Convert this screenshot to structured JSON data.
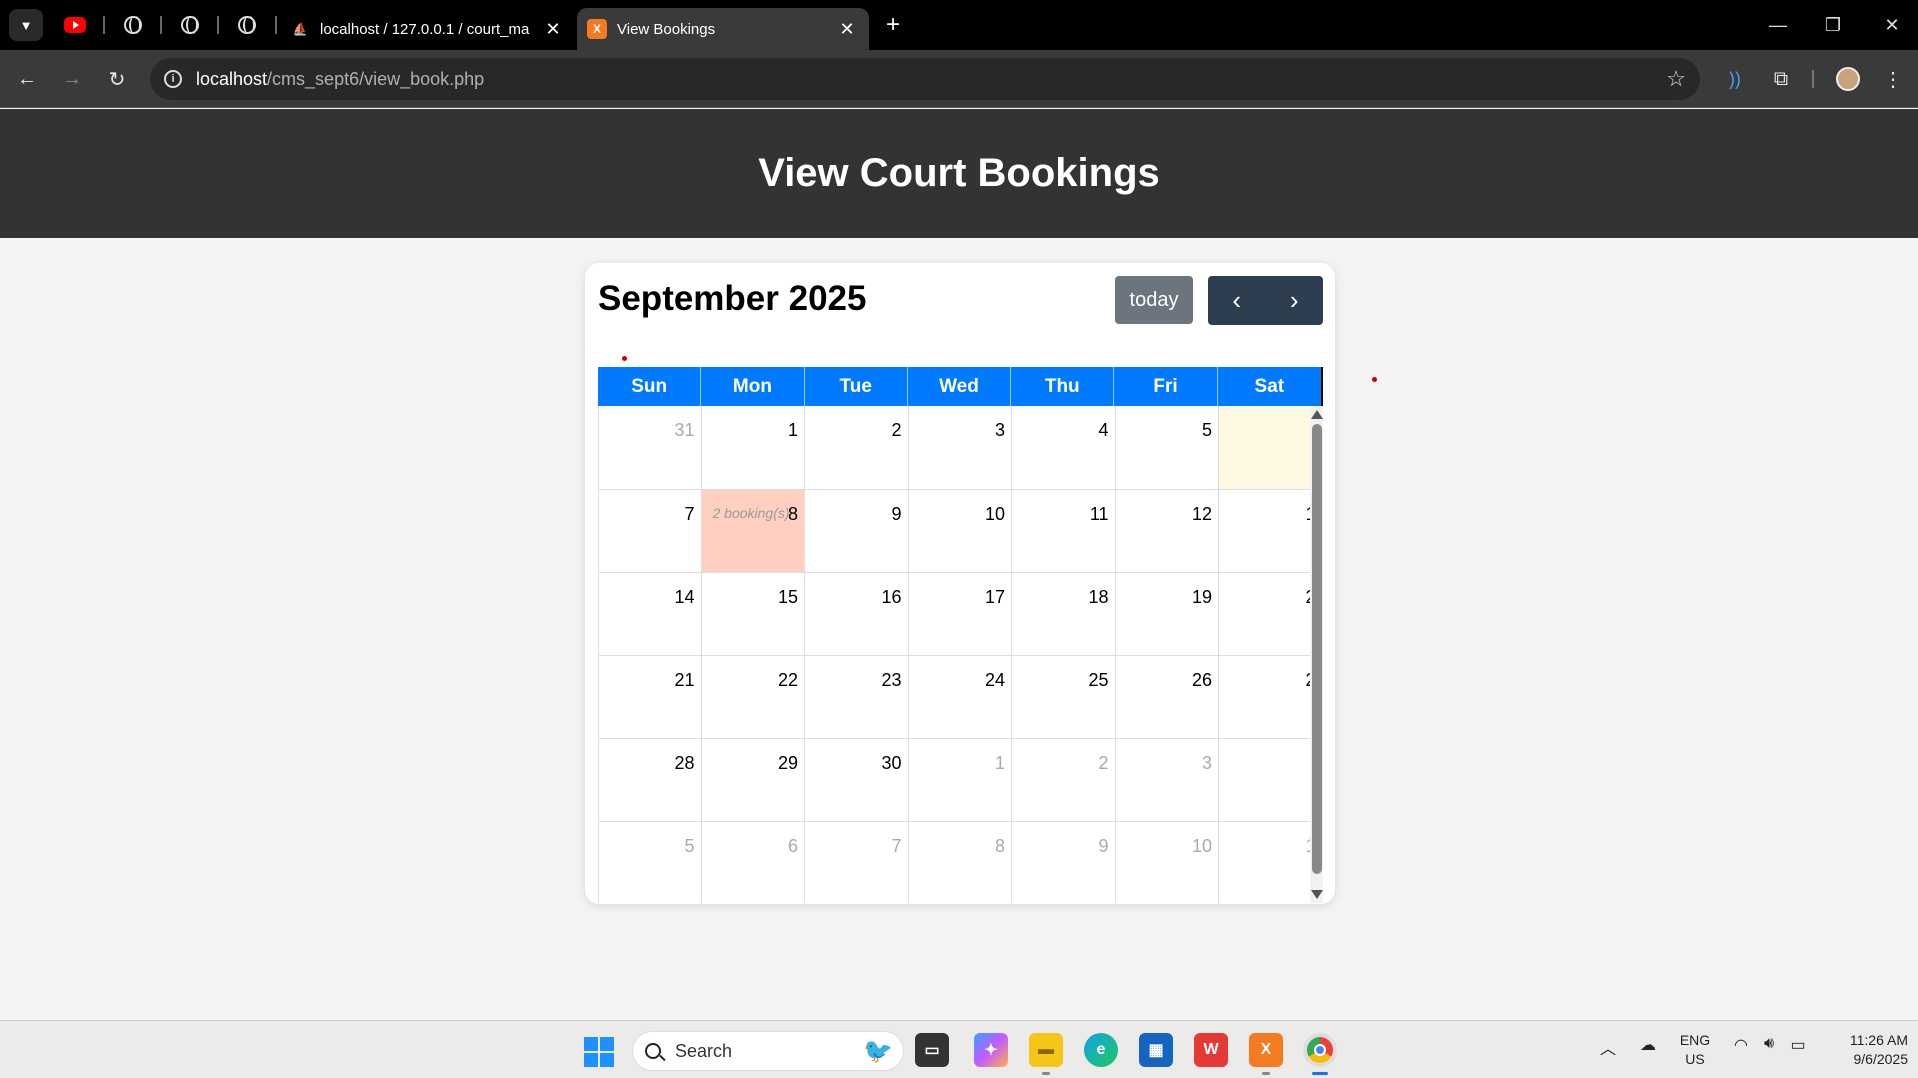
{
  "browser": {
    "tabs": [
      {
        "title": "localhost / 127.0.0.1 / court_ma",
        "icon": "phpmyadmin-icon"
      },
      {
        "title": "View Bookings",
        "icon": "xampp-icon",
        "active": true
      }
    ],
    "url_host": "localhost",
    "url_path": "/cms_sept6/view_book.php"
  },
  "page": {
    "title": "View Court Bookings"
  },
  "calendar": {
    "title": "September 2025",
    "today_label": "today",
    "prev_label": "‹",
    "next_label": "›",
    "weekdays": [
      "Sun",
      "Mon",
      "Tue",
      "Wed",
      "Thu",
      "Fri",
      "Sat"
    ],
    "weeks": [
      [
        {
          "d": "31",
          "other": true
        },
        {
          "d": "1"
        },
        {
          "d": "2"
        },
        {
          "d": "3"
        },
        {
          "d": "4"
        },
        {
          "d": "5"
        },
        {
          "d": "",
          "today": true
        }
      ],
      [
        {
          "d": "7"
        },
        {
          "d": "8",
          "booking": "2 booking(s)"
        },
        {
          "d": "9"
        },
        {
          "d": "10"
        },
        {
          "d": "11"
        },
        {
          "d": "12"
        },
        {
          "d": "1"
        }
      ],
      [
        {
          "d": "14"
        },
        {
          "d": "15"
        },
        {
          "d": "16"
        },
        {
          "d": "17"
        },
        {
          "d": "18"
        },
        {
          "d": "19"
        },
        {
          "d": "2"
        }
      ],
      [
        {
          "d": "21"
        },
        {
          "d": "22"
        },
        {
          "d": "23"
        },
        {
          "d": "24"
        },
        {
          "d": "25"
        },
        {
          "d": "26"
        },
        {
          "d": "2"
        }
      ],
      [
        {
          "d": "28"
        },
        {
          "d": "29"
        },
        {
          "d": "30"
        },
        {
          "d": "1",
          "other": true
        },
        {
          "d": "2",
          "other": true
        },
        {
          "d": "3",
          "other": true
        },
        {
          "d": "",
          "other": true
        }
      ],
      [
        {
          "d": "5",
          "other": true
        },
        {
          "d": "6",
          "other": true
        },
        {
          "d": "7",
          "other": true
        },
        {
          "d": "8",
          "other": true
        },
        {
          "d": "9",
          "other": true
        },
        {
          "d": "10",
          "other": true
        },
        {
          "d": "1",
          "other": true
        }
      ]
    ],
    "colors": {
      "header": "#007bff",
      "today": "#fdf8e1",
      "booked": "#ffd0c2",
      "nav": "#2c3e50"
    }
  },
  "taskbar": {
    "search_placeholder": "Search",
    "lang_line1": "ENG",
    "lang_line2": "US",
    "time": "11:26 AM",
    "date": "9/6/2025"
  }
}
